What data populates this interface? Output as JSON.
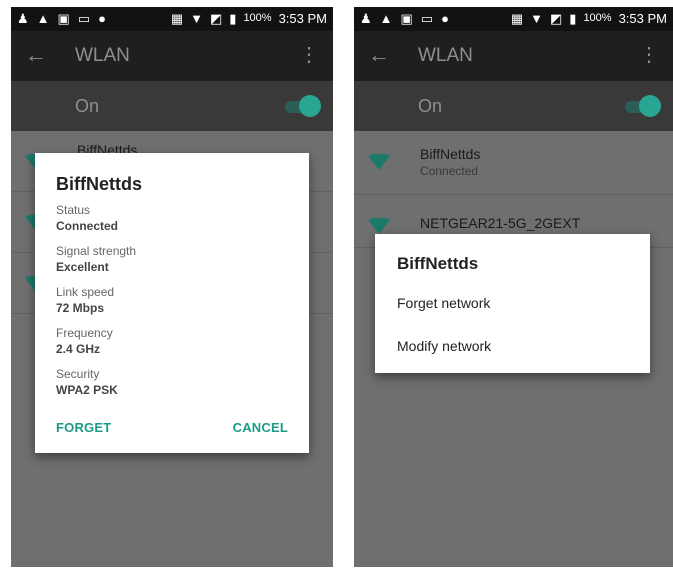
{
  "status_bar": {
    "left_icons": [
      "person-icon",
      "warning-icon",
      "image-icon",
      "cast-icon",
      "android-icon"
    ],
    "right_icons": [
      "nfc-icon",
      "wifi-icon",
      "no-sim-icon",
      "battery-icon"
    ],
    "battery": "100%",
    "time": "3:53 PM"
  },
  "app_bar": {
    "title": "WLAN"
  },
  "wlan_toggle": {
    "label": "On",
    "state": "on"
  },
  "networks": [
    {
      "name": "BiffNettds",
      "status": "Connected"
    },
    {
      "name": "NETGEAR21-5G_2GEXT",
      "status": ""
    }
  ],
  "left_list_partial_name": "BiffNettds",
  "info_dialog": {
    "title": "BiffNettds",
    "fields": [
      {
        "label": "Status",
        "value": "Connected"
      },
      {
        "label": "Signal strength",
        "value": "Excellent"
      },
      {
        "label": "Link speed",
        "value": "72 Mbps"
      },
      {
        "label": "Frequency",
        "value": "2.4 GHz"
      },
      {
        "label": "Security",
        "value": "WPA2 PSK"
      }
    ],
    "forget_button": "FORGET",
    "cancel_button": "CANCEL"
  },
  "menu_dialog": {
    "title": "BiffNettds",
    "items": [
      "Forget network",
      "Modify network"
    ]
  },
  "colors": {
    "accent": "#1c9a88",
    "toggle_on": "#2aa593",
    "wifi_icon": "#1b7a6a"
  }
}
